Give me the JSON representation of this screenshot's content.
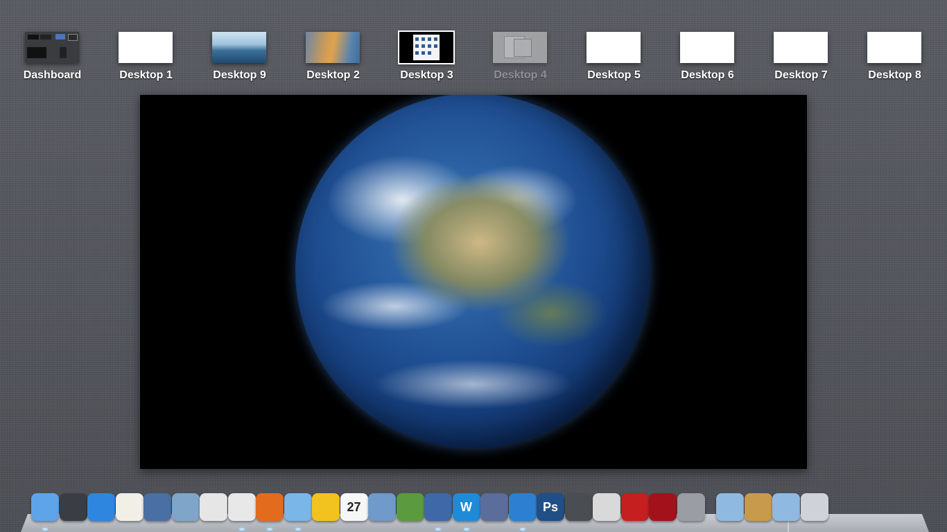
{
  "spaces": [
    {
      "label": "Dashboard"
    },
    {
      "label": "Desktop 1"
    },
    {
      "label": "Desktop 9"
    },
    {
      "label": "Desktop 2"
    },
    {
      "label": "Desktop 3"
    },
    {
      "label": "Desktop 4"
    },
    {
      "label": "Desktop 5"
    },
    {
      "label": "Desktop 6"
    },
    {
      "label": "Desktop 7"
    },
    {
      "label": "Desktop 8"
    }
  ],
  "dock": {
    "items": [
      {
        "icon": "finder-icon",
        "color": "#5ea4e8"
      },
      {
        "icon": "dashboard-widgets-icon",
        "color": "#3a3d43"
      },
      {
        "icon": "app-store-icon",
        "color": "#2f86de"
      },
      {
        "icon": "solitaire-icon",
        "color": "#f2efe6"
      },
      {
        "icon": "vmware-fusion-icon",
        "color": "#4a6fa5"
      },
      {
        "icon": "remote-desktop-icon",
        "color": "#7fa6c8"
      },
      {
        "icon": "image-capture-icon",
        "color": "#e6e6e6"
      },
      {
        "icon": "chrome-icon",
        "color": "#e8e8e8"
      },
      {
        "icon": "firefox-icon",
        "color": "#e36b1d"
      },
      {
        "icon": "safari-icon",
        "color": "#7ab6e8"
      },
      {
        "icon": "twitter-bird-icon",
        "color": "#f2c31f"
      },
      {
        "icon": "calendar-icon",
        "color": "#f6f6f6",
        "text": "27"
      },
      {
        "icon": "mail-stamp-icon",
        "color": "#6f9ac9"
      },
      {
        "icon": "iphoto-icon",
        "color": "#5b9a3e"
      },
      {
        "icon": "keynote-chart-icon",
        "color": "#3e68a8"
      },
      {
        "icon": "word-processor-icon",
        "color": "#1f8ad8",
        "text": "W"
      },
      {
        "icon": "quill-icon",
        "color": "#5a6d9b"
      },
      {
        "icon": "itunes-icon",
        "color": "#2d7fd1"
      },
      {
        "icon": "photoshop-icon",
        "color": "#1f4f86",
        "text": "Ps"
      },
      {
        "icon": "facetime-icon",
        "color": "#4a4d52"
      },
      {
        "icon": "software-update-icon",
        "color": "#d9d9d9"
      },
      {
        "icon": "front-row-chair-icon",
        "color": "#c51f1f"
      },
      {
        "icon": "photo-booth-icon",
        "color": "#a3121b"
      },
      {
        "icon": "system-preferences-icon",
        "color": "#9a9da3"
      },
      {
        "icon": "downloads-folder-icon",
        "color": "#8fb9e0"
      },
      {
        "icon": "address-book-icon",
        "color": "#c79a4c"
      },
      {
        "icon": "applications-folder-icon",
        "color": "#8fb9e0"
      },
      {
        "icon": "trash-icon",
        "color": "#cfd3d9"
      }
    ]
  }
}
